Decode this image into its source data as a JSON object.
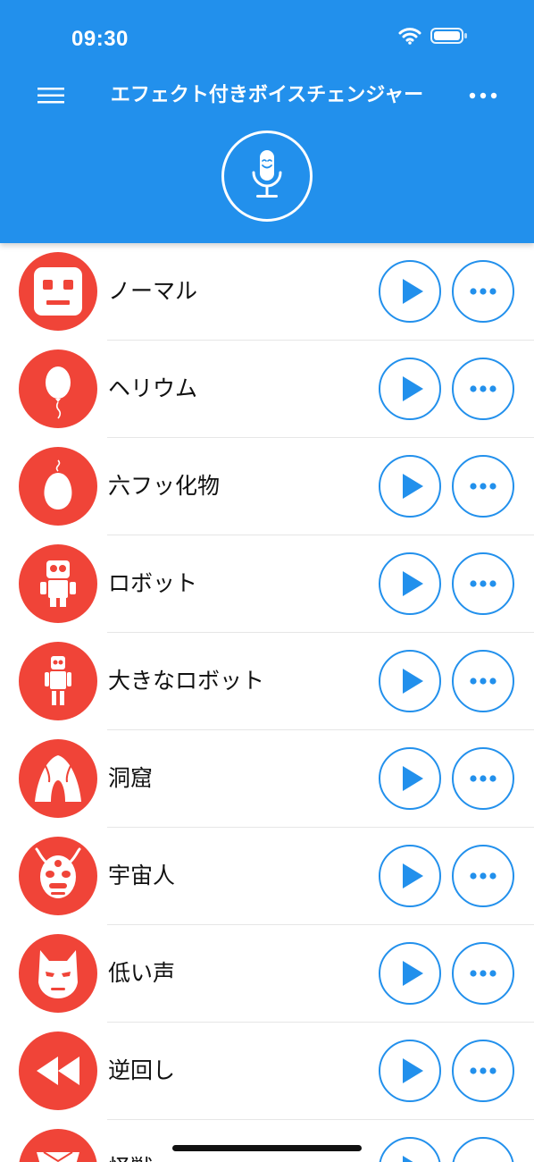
{
  "status_bar": {
    "time": "09:30",
    "wifi_icon": "wifi-icon",
    "battery_icon": "battery-icon"
  },
  "header": {
    "title": "エフェクト付きボイスチェンジャー",
    "menu_icon": "hamburger-menu-icon",
    "more_icon": "more-horizontal-icon",
    "record_icon": "microphone-icon"
  },
  "colors": {
    "header": "#2290EC",
    "accent": "#2290EC",
    "effect_icon_bg": "#F04438",
    "text": "#111111",
    "divider": "#E6E6E6"
  },
  "effects": [
    {
      "label": "ノーマル",
      "icon": "robot-face-icon"
    },
    {
      "label": "ヘリウム",
      "icon": "balloon-icon"
    },
    {
      "label": "六フッ化物",
      "icon": "gas-bubble-icon"
    },
    {
      "label": "ロボット",
      "icon": "robot-icon"
    },
    {
      "label": "大きなロボット",
      "icon": "big-robot-icon"
    },
    {
      "label": "洞窟",
      "icon": "cave-icon"
    },
    {
      "label": "宇宙人",
      "icon": "alien-icon"
    },
    {
      "label": "低い声",
      "icon": "mask-face-icon"
    },
    {
      "label": "逆回し",
      "icon": "rewind-icon"
    },
    {
      "label": "怪獣",
      "icon": "monster-icon"
    }
  ],
  "row_actions": {
    "play_icon": "play-icon",
    "options_icon": "more-options-icon"
  }
}
